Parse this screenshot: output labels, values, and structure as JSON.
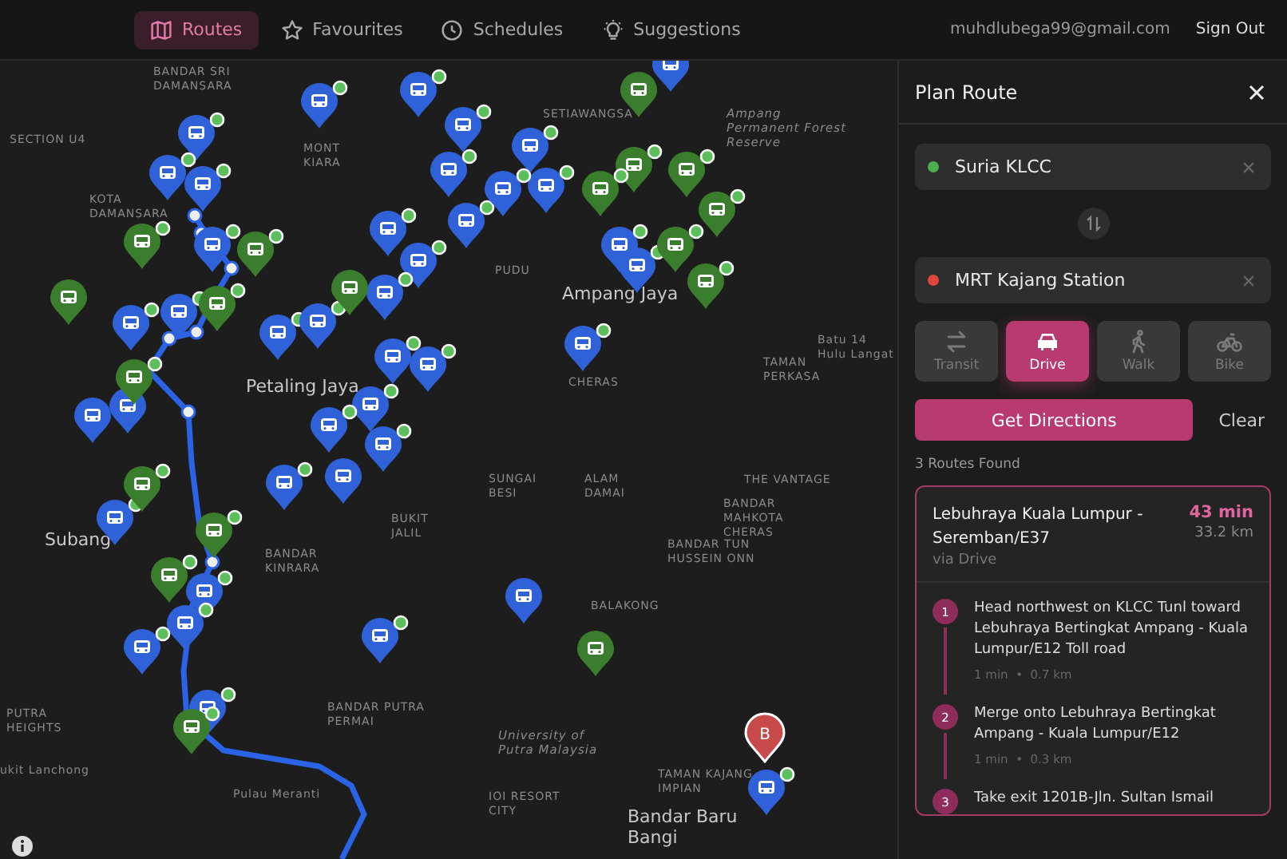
{
  "nav": {
    "tabs": [
      {
        "label": "Routes",
        "selected": true
      },
      {
        "label": "Favourites",
        "selected": false
      },
      {
        "label": "Schedules",
        "selected": false
      },
      {
        "label": "Suggestions",
        "selected": false
      }
    ],
    "email": "muhdlubega99@gmail.com",
    "sign_out": "Sign Out"
  },
  "map": {
    "labels": [
      {
        "text": "BANDAR SRI DAMANSARA",
        "kind": "area"
      },
      {
        "text": "SETIAWANGSA",
        "kind": "area"
      },
      {
        "text": "SECTION U4",
        "kind": "area"
      },
      {
        "text": "MONT KIARA",
        "kind": "area"
      },
      {
        "text": "Ampang Permanent Forest Reserve",
        "kind": "park"
      },
      {
        "text": "KOTA DAMANSARA",
        "kind": "area"
      },
      {
        "text": "PUDU",
        "kind": "area"
      },
      {
        "text": "Ampang Jaya",
        "kind": "city"
      },
      {
        "text": "Batu 14 Hulu Langat",
        "kind": "area"
      },
      {
        "text": "TAMAN PERKASA",
        "kind": "area"
      },
      {
        "text": "Petaling Jaya",
        "kind": "city"
      },
      {
        "text": "CHERAS",
        "kind": "area"
      },
      {
        "text": "SUNGAI BESI",
        "kind": "area"
      },
      {
        "text": "ALAM DAMAI",
        "kind": "area"
      },
      {
        "text": "THE VANTAGE",
        "kind": "area"
      },
      {
        "text": "BANDAR MAHKOTA CHERAS",
        "kind": "area"
      },
      {
        "text": "Subang",
        "kind": "city"
      },
      {
        "text": "BUKIT JALIL",
        "kind": "area"
      },
      {
        "text": "BANDAR TUN HUSSEIN ONN",
        "kind": "area"
      },
      {
        "text": "BANDAR KINRARA",
        "kind": "area"
      },
      {
        "text": "BALAKONG",
        "kind": "area"
      },
      {
        "text": "BANDAR PUTRA PERMAI",
        "kind": "area"
      },
      {
        "text": "PUTRA HEIGHTS",
        "kind": "area"
      },
      {
        "text": "University of Putra Malaysia",
        "kind": "park"
      },
      {
        "text": "ukit Lanchong",
        "kind": "area"
      },
      {
        "text": "TAMAN KAJANG IMPIAN",
        "kind": "area"
      },
      {
        "text": "Pulau Meranti",
        "kind": "area"
      },
      {
        "text": "IOI RESORT CITY",
        "kind": "area"
      },
      {
        "text": "Bandar Baru Bangi",
        "kind": "city"
      }
    ],
    "pins": [
      {
        "color": "#2f62d8",
        "badge": true
      },
      {
        "color": "#2f62d8",
        "badge": true
      },
      {
        "color": "#2f62d8",
        "badge": true
      },
      {
        "color": "#2f62d8",
        "badge": true
      },
      {
        "color": "#2f62d8",
        "badge": true
      },
      {
        "color": "#2f62d8",
        "badge": true
      },
      {
        "color": "#2f62d8",
        "badge": true
      },
      {
        "color": "#2f62d8",
        "badge": true
      },
      {
        "color": "#2f62d8",
        "badge": true
      },
      {
        "color": "#2f62d8",
        "badge": true
      },
      {
        "color": "#2f62d8",
        "badge": true
      },
      {
        "color": "#2f62d8",
        "badge": true
      },
      {
        "color": "#2f62d8",
        "badge": true
      },
      {
        "color": "#2f62d8",
        "badge": true
      },
      {
        "color": "#2f62d8",
        "badge": true
      },
      {
        "color": "#2f62d8",
        "badge": true
      },
      {
        "color": "#2f62d8",
        "badge": true
      },
      {
        "color": "#2f62d8",
        "badge": true
      },
      {
        "color": "#2f62d8",
        "badge": false
      },
      {
        "color": "#2f62d8",
        "badge": false
      },
      {
        "color": "#2f62d8",
        "badge": true
      },
      {
        "color": "#2f62d8",
        "badge": false
      },
      {
        "color": "#2f62d8",
        "badge": true
      },
      {
        "color": "#2f62d8",
        "badge": true
      },
      {
        "color": "#2f62d8",
        "badge": true
      },
      {
        "color": "#2f62d8",
        "badge": true
      },
      {
        "color": "#2f62d8",
        "badge": true
      },
      {
        "color": "#2f62d8",
        "badge": true
      },
      {
        "color": "#2f62d8",
        "badge": false
      },
      {
        "color": "#2f62d8",
        "badge": true
      },
      {
        "color": "#2f62d8",
        "badge": true
      },
      {
        "color": "#2f62d8",
        "badge": true
      },
      {
        "color": "#2f62d8",
        "badge": true
      },
      {
        "color": "#2f62d8",
        "badge": true
      },
      {
        "color": "#2f62d8",
        "badge": true
      },
      {
        "color": "#2f62d8",
        "badge": true
      },
      {
        "color": "#2f62d8",
        "badge": true
      },
      {
        "color": "#2f62d8",
        "badge": true
      },
      {
        "color": "#2f62d8",
        "badge": true
      },
      {
        "color": "#2f62d8",
        "badge": false
      },
      {
        "color": "#3a7d2c",
        "badge": false
      },
      {
        "color": "#3a7d2c",
        "badge": true
      },
      {
        "color": "#3a7d2c",
        "badge": true
      },
      {
        "color": "#3a7d2c",
        "badge": false
      },
      {
        "color": "#3a7d2c",
        "badge": true
      },
      {
        "color": "#3a7d2c",
        "badge": true
      },
      {
        "color": "#3a7d2c",
        "badge": true
      },
      {
        "color": "#3a7d2c",
        "badge": true
      },
      {
        "color": "#3a7d2c",
        "badge": true
      },
      {
        "color": "#3a7d2c",
        "badge": true
      },
      {
        "color": "#3a7d2c",
        "badge": false
      },
      {
        "color": "#3a7d2c",
        "badge": false
      },
      {
        "color": "#3a7d2c",
        "badge": true
      },
      {
        "color": "#3a7d2c",
        "badge": true
      },
      {
        "color": "#3a7d2c",
        "badge": true
      },
      {
        "color": "#3a7d2c",
        "badge": true
      },
      {
        "color": "#3a7d2c",
        "badge": true
      },
      {
        "color": "#3a7d2c",
        "badge": true
      }
    ],
    "destination_marker": "B"
  },
  "panel": {
    "title": "Plan Route",
    "origin": {
      "value": "Suria KLCC",
      "color": "#4caf50"
    },
    "destination": {
      "value": "MRT Kajang Station",
      "color": "#e0463c"
    },
    "modes": [
      {
        "label": "Transit",
        "selected": false
      },
      {
        "label": "Drive",
        "selected": true
      },
      {
        "label": "Walk",
        "selected": false
      },
      {
        "label": "Bike",
        "selected": false
      }
    ],
    "get_directions": "Get Directions",
    "clear": "Clear",
    "results_count": "3 Routes Found",
    "route": {
      "name": "Lebuhraya Kuala Lumpur - Seremban/E37",
      "via": "via Drive",
      "duration": "43 min",
      "distance": "33.2 km",
      "steps": [
        {
          "number": "1",
          "text": "Head northwest on KLCC Tunl toward Lebuhraya Bertingkat Ampang - Kuala Lumpur/E12 Toll road",
          "meta": "1 min  •  0.7 km"
        },
        {
          "number": "2",
          "text": "Merge onto Lebuhraya Bertingkat Ampang - Kuala Lumpur/E12",
          "meta": "1 min  •  0.3 km"
        },
        {
          "number": "3",
          "text": "Take exit 1201B-Jln. Sultan Ismail"
        }
      ]
    }
  }
}
